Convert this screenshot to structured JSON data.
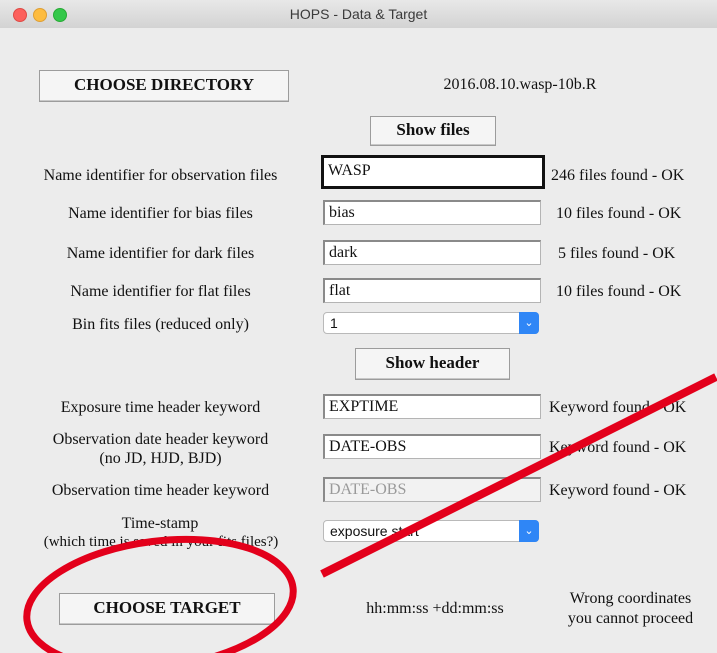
{
  "window": {
    "title": "HOPS - Data & Target"
  },
  "directory": {
    "button_label": "CHOOSE DIRECTORY",
    "value": "2016.08.10.wasp-10b.R"
  },
  "show_files_label": "Show files",
  "rows": [
    {
      "label": "Name identifier for observation files",
      "value": "WASP",
      "status": "246 files found - OK"
    },
    {
      "label": "Name identifier for bias files",
      "value": "bias",
      "status": "10 files found - OK"
    },
    {
      "label": "Name identifier for dark files",
      "value": "dark",
      "status": "5 files found - OK"
    },
    {
      "label": "Name identifier for flat files",
      "value": "flat",
      "status": "10 files found - OK"
    }
  ],
  "bin": {
    "label": "Bin fits files (reduced only)",
    "value": "1"
  },
  "show_header_label": "Show header",
  "keywords": [
    {
      "label": "Exposure time header keyword",
      "value": "EXPTIME",
      "status": "Keyword found - OK"
    },
    {
      "label1": "Observation date header keyword",
      "label2": "(no JD, HJD, BJD)",
      "value": "DATE-OBS",
      "status": "Keyword found - OK"
    },
    {
      "label": "Observation time header keyword",
      "value": "DATE-OBS",
      "status": "Keyword found - OK"
    }
  ],
  "timestamp": {
    "label1": "Time-stamp",
    "label2": "(which time is saved in your fits files?)",
    "value": "exposure start"
  },
  "target": {
    "button_label": "CHOOSE TARGET",
    "coords_format": "hh:mm:ss +dd:mm:ss",
    "message1": "Wrong coordinates",
    "message2": "you cannot proceed"
  },
  "annotation_color": "#e3001b"
}
